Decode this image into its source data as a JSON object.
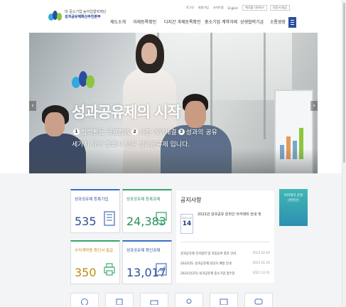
{
  "header": {
    "logo_line1": "대 중소기업·농어업협력재단",
    "logo_line2": "성과공유제확산추진본부",
    "util_links": [
      "로그인",
      "회원가입",
      "사이트맵",
      "English"
    ],
    "util_box1": "에너폴 더보터스",
    "util_box2": "인증서 발급",
    "nav": [
      "제도소개",
      "과제등록확인",
      "다지간 과제등록확인",
      "중소기업 계약과제",
      "상생협력기금",
      "소통광장"
    ]
  },
  "hero": {
    "title": "성과공유제의 시작",
    "steps": [
      {
        "num": "1",
        "label": "협력활동 목표합의"
      },
      {
        "num": "2",
        "label": "사전 계약체결"
      },
      {
        "num": "3",
        "label": "성과의 공유"
      }
    ],
    "subtitle": "세가지 요건 충족시 모두 성과공유제 입니다."
  },
  "stats": [
    {
      "title": "성과공유제 등록기업",
      "value": "535",
      "color": "#2a4f9e",
      "icon": "building-icon"
    },
    {
      "title": "성과공유제 등록과제",
      "value": "24,383",
      "color": "#2a8f5b",
      "icon": "monitor-icon"
    },
    {
      "title": "수익계약용 확인서 발급",
      "value": "350",
      "color": "#c08a11",
      "icon": "printer-icon"
    },
    {
      "title": "성과공유제 확인과제",
      "value": "13,017",
      "color": "#2a4f9e",
      "icon": "chart-icon"
    }
  ],
  "notice": {
    "title": "공지사항",
    "feature_date_ym": "2022.03",
    "feature_date_day": "14",
    "feature_text": "2022년 성과공유 온라인 아카데미 안내 및",
    "items": [
      {
        "text": "성과공유제 전자협약 및 자동등록 절차 안내",
        "date": "2022.02.04"
      },
      {
        "text": "2022년도 성과공유제 담당자 배정 안내",
        "date": "2022.01.20"
      },
      {
        "text": "2021년(2차) 성과공유제 중소기업 접수현",
        "date": "2021.12.01"
      }
    ]
  },
  "banner": {
    "line1": "아카데미 운영",
    "line2": "(온라인)"
  },
  "colors": {
    "brand_navy": "#2c4d9e",
    "brand_green": "#33a66b"
  }
}
